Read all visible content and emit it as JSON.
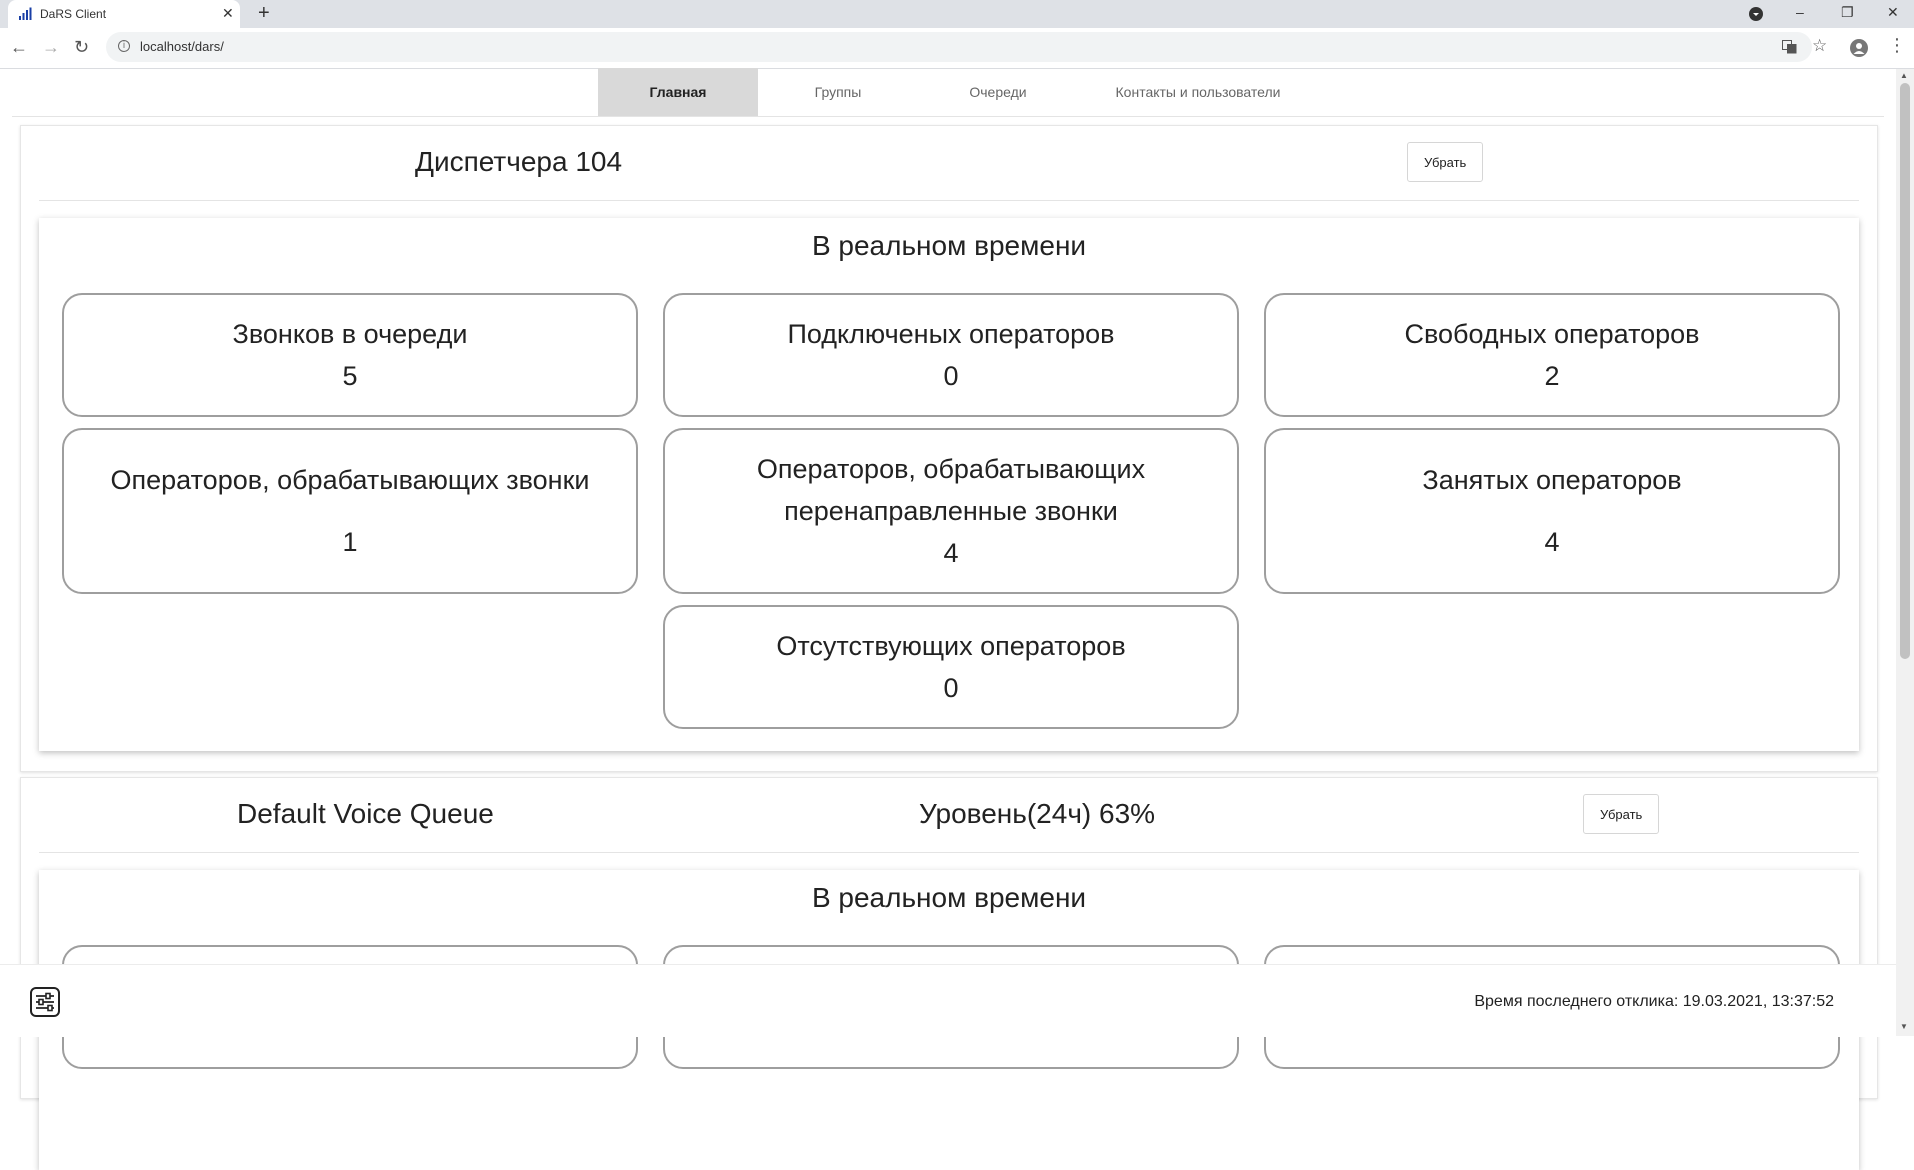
{
  "browser": {
    "tab_title": "DaRS Client",
    "tab_close": "✕",
    "new_tab": "+",
    "url": "localhost/dars/",
    "back": "←",
    "forward": "→",
    "reload": "↻",
    "star": "☆",
    "menu": "⋮",
    "win_minimize": "–",
    "win_restore": "❐",
    "win_close": "✕"
  },
  "nav": {
    "tabs": [
      "Главная",
      "Группы",
      "Очереди",
      "Контакты и пользователи"
    ],
    "active_tab": "Главная"
  },
  "panels": [
    {
      "title": "Диспетчера 104",
      "remove_label": "Убрать",
      "realtime_title": "В реальном времени",
      "stats": [
        {
          "label": "Звонков в очереди",
          "value": "5"
        },
        {
          "label": "Подключеных операторов",
          "value": "0"
        },
        {
          "label": "Свободных операторов",
          "value": "2"
        },
        {
          "label": "Операторов, обрабатывающих звонки",
          "value": "1"
        },
        {
          "label": "Операторов, обрабатывающих перенаправленные звонки",
          "value": "4"
        },
        {
          "label": "Занятых операторов",
          "value": "4"
        },
        {
          "label": "Отсутствующих операторов",
          "value": "0"
        }
      ]
    },
    {
      "title": "Default Voice Queue",
      "level": "Уровень(24ч) 63%",
      "remove_label": "Убрать",
      "realtime_title": "В реальном времени"
    }
  ],
  "footer": {
    "last_response": "Время последнего отклика: 19.03.2021, 13:37:52"
  },
  "icons": {
    "favicon": "signal-bars-icon",
    "settings": "sliders-settings-icon",
    "translate": "translate-icon",
    "profile": "profile-icon"
  },
  "colors": {
    "active_tab_bg": "#d9d9d9",
    "stat_border": "#9e9e9e",
    "favicon": "#1a3fa6"
  }
}
